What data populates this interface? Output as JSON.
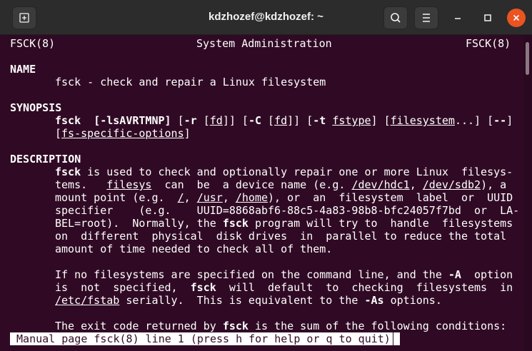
{
  "window": {
    "title": "kdzhozef@kdzhozef: ~",
    "colors": {
      "terminal_bg": "#300a24",
      "close_button": "#e95420",
      "text": "#ffffff"
    }
  },
  "titlebar": {
    "new_tab_icon": "new-tab-icon",
    "search_icon": "search-icon",
    "menu_icon": "hamburger-menu-icon",
    "minimize_icon": "minimize-icon",
    "maximize_icon": "maximize-icon",
    "close_icon": "close-icon"
  },
  "manpage": {
    "header": {
      "left": "FSCK(8)",
      "center": "System Administration",
      "right": "FSCK(8)"
    },
    "name_heading": "NAME",
    "name_line": "fsck - check and repair a Linux filesystem",
    "synopsis_heading": "SYNOPSIS",
    "synopsis": {
      "cmd": "fsck",
      "opt_lsa": "[-lsAVRTMNP]",
      "r_pre": " [",
      "r_flag": "-r",
      "r_mid": " [",
      "fd1": "fd",
      "r_post": "]] [",
      "c_flag": "-C",
      "c_mid": " [",
      "fd2": "fd",
      "c_post": "]] [",
      "t_flag": "-t",
      "t_sp": " ",
      "fstype": "fstype",
      "t_post": "] [",
      "filesystem": "filesystem",
      "fs_post": "...] [",
      "dashdash": "--",
      "dd_post": "]",
      "l2_pre": "[",
      "fs_specific": "fs-specific-options",
      "l2_post": "]"
    },
    "description_heading": "DESCRIPTION",
    "p1": {
      "l1_bold": "fsck",
      "l1_rest": " is used to check and optionally repair one or more Linux  filesys-",
      "l2_a": "tems.   ",
      "l2_filesys": "filesys",
      "l2_b": "  can  be  a device name (e.g. ",
      "l2_dev1": "/dev/hdc1",
      "l2_c": ", ",
      "l2_dev2": "/dev/sdb2",
      "l2_d": "), a",
      "l3_a": "mount point (e.g.  ",
      "l3_root": "/",
      "l3_b": ", ",
      "l3_usr": "/usr",
      "l3_c": ", ",
      "l3_home": "/home",
      "l3_d": "), or  an  filesystem  label  or  UUID",
      "l4": "specifier    (e.g.    UUID=8868abf6-88c5-4a83-98b8-bfc24057f7bd  or  LA-",
      "l5_a": "BEL=root).  Normally, the ",
      "l5_bold": "fsck",
      "l5_b": " program will try to  handle  filesystems",
      "l6": "on  different  physical  disk drives  in  parallel to reduce the total",
      "l7": "amount of time needed to check all of them."
    },
    "p2": {
      "l1_a": "If no filesystems are specified on the command line, and the ",
      "l1_bold": "-A",
      "l1_b": "  option",
      "l2_a": "is  not  specified,  ",
      "l2_bold": "fsck",
      "l2_b": "  will  default  to  checking  filesystems  in",
      "l3_fstab": "/etc/fstab",
      "l3_a": " serially.  This is equivalent to the ",
      "l3_bold": "-As",
      "l3_b": " options."
    },
    "p3": {
      "l1_a": "The exit code returned by ",
      "l1_bold": "fsck",
      "l1_b": " is the sum of the following conditions:"
    },
    "status": " Manual page fsck(8) line 1 (press h for help or q to quit)"
  }
}
